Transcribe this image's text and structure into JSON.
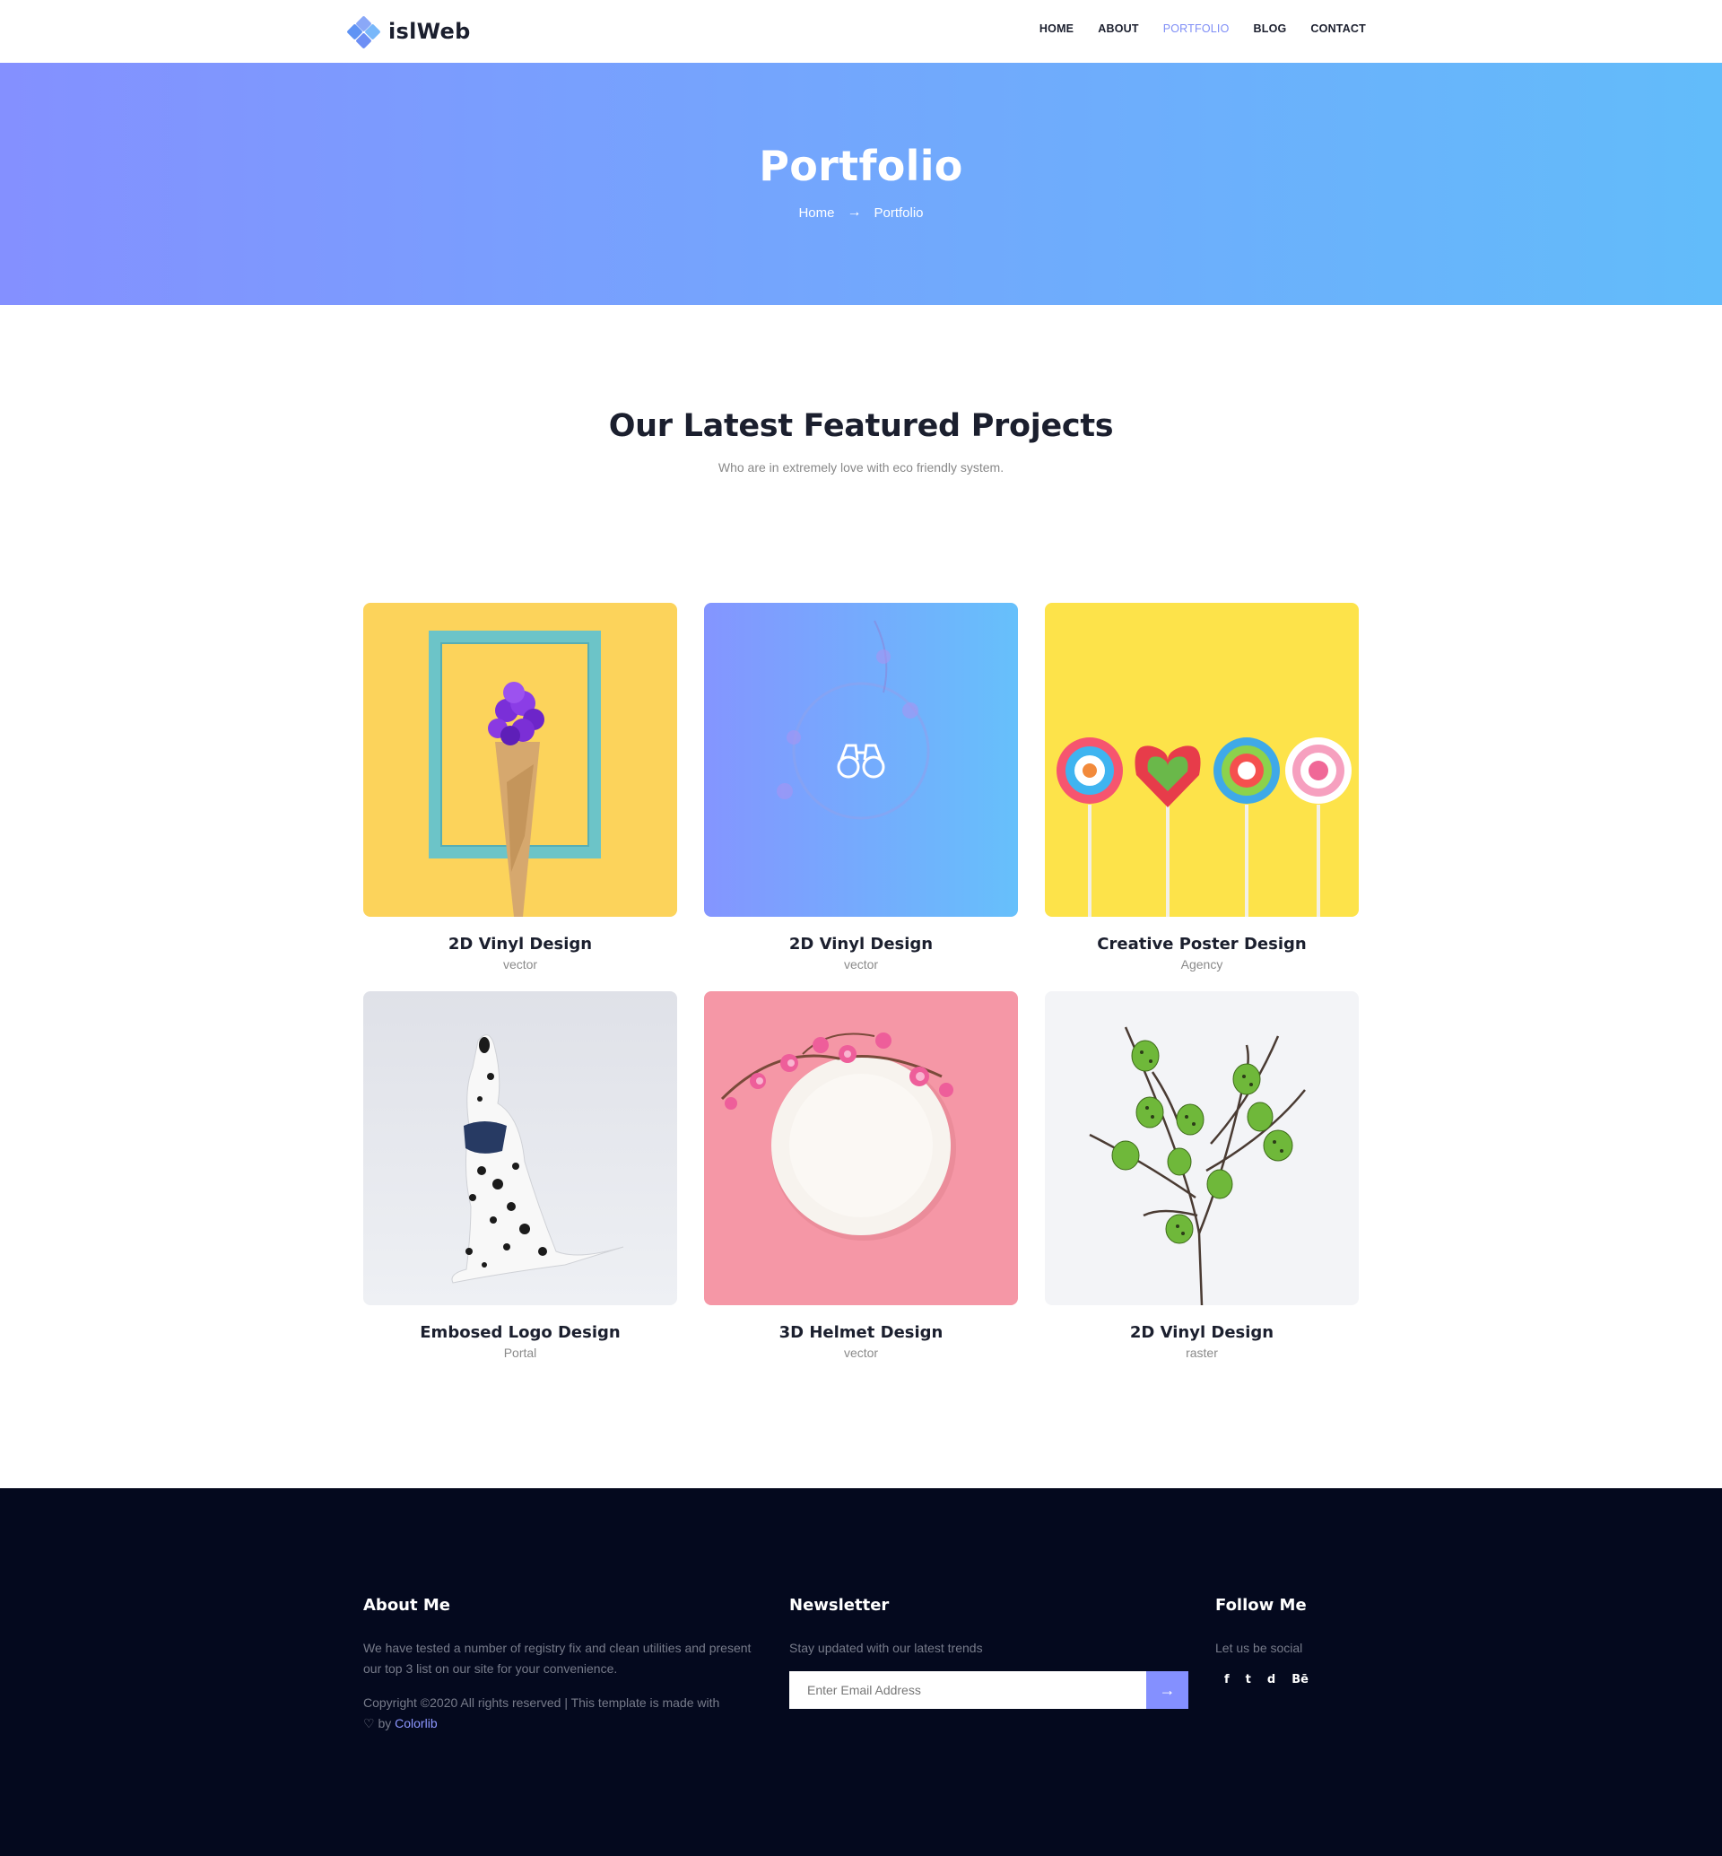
{
  "header": {
    "brand": "islWeb",
    "nav": [
      "HOME",
      "ABOUT",
      "PORTFOLIO",
      "BLOG",
      "CONTACT"
    ]
  },
  "banner": {
    "title": "Portfolio",
    "breadcrumb": {
      "home": "Home",
      "arrow": "→",
      "current": "Portfolio"
    }
  },
  "section": {
    "title": "Our Latest Featured Projects",
    "subtitle": "Who are in extremely love with eco friendly system."
  },
  "projects": [
    {
      "title": "2D Vinyl Design",
      "category": "vector"
    },
    {
      "title": "2D Vinyl Design",
      "category": "vector"
    },
    {
      "title": "Creative Poster Design",
      "category": "Agency"
    },
    {
      "title": "Embosed Logo Design",
      "category": "Portal"
    },
    {
      "title": "3D Helmet Design",
      "category": "vector"
    },
    {
      "title": "2D Vinyl Design",
      "category": "raster"
    }
  ],
  "footer": {
    "about": {
      "title": "About Me",
      "text": "We have tested a number of registry fix and clean utilities and present our top 3 list on our site for your convenience.",
      "copyright": "Copyright ©2020 All rights reserved | This template is made with",
      "heart": "♡",
      "by": "by",
      "credit": "Colorlib"
    },
    "newsletter": {
      "title": "Newsletter",
      "text": "Stay updated with our latest trends",
      "placeholder": "Enter Email Address",
      "button": "→"
    },
    "follow": {
      "title": "Follow Me",
      "text": "Let us be social",
      "icons": [
        "f",
        "t",
        "d",
        "Bē"
      ]
    }
  },
  "colors": {
    "accent": "#8490ff",
    "banner_start": "#8490ff",
    "banner_end": "#62bcfa",
    "footer_bg": "#04091e"
  }
}
